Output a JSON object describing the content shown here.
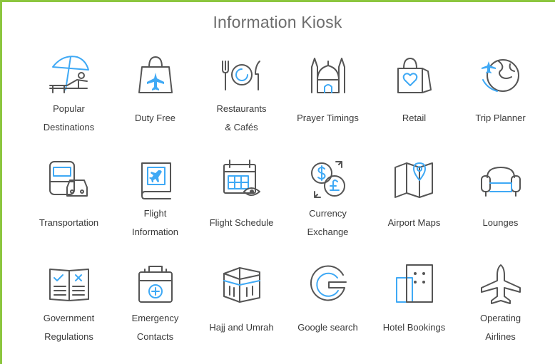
{
  "title": "Information Kiosk",
  "colors": {
    "accent": "#3fa9f5",
    "frame": "#8cc63f",
    "icon": "#555555",
    "text": "#3a3a3a"
  },
  "tiles": [
    {
      "icon": "beach-umbrella-icon",
      "lines": [
        "Popular",
        "Destinations"
      ]
    },
    {
      "icon": "shopping-bag-plane-icon",
      "lines": [
        "Duty Free"
      ]
    },
    {
      "icon": "plate-cutlery-icon",
      "lines": [
        "Restaurants",
        "& Cafés"
      ]
    },
    {
      "icon": "mosque-icon",
      "lines": [
        "Prayer Timings"
      ]
    },
    {
      "icon": "shopping-bag-heart-icon",
      "lines": [
        "Retail"
      ]
    },
    {
      "icon": "globe-plane-icon",
      "lines": [
        "Trip Planner"
      ]
    },
    {
      "icon": "bus-car-icon",
      "lines": [
        "Transportation"
      ]
    },
    {
      "icon": "book-plane-icon",
      "lines": [
        "Flight",
        "Information"
      ]
    },
    {
      "icon": "calendar-eye-icon",
      "lines": [
        "Flight Schedule"
      ]
    },
    {
      "icon": "currency-exchange-icon",
      "lines": [
        "Currency",
        "Exchange"
      ]
    },
    {
      "icon": "map-pin-icon",
      "lines": [
        "Airport Maps"
      ]
    },
    {
      "icon": "armchair-icon",
      "lines": [
        "Lounges"
      ]
    },
    {
      "icon": "regulations-book-icon",
      "lines": [
        "Government",
        "Regulations"
      ]
    },
    {
      "icon": "first-aid-kit-icon",
      "lines": [
        "Emergency",
        "Contacts"
      ]
    },
    {
      "icon": "kaaba-icon",
      "lines": [
        "Hajj and Umrah"
      ]
    },
    {
      "icon": "google-icon",
      "lines": [
        "Google search"
      ]
    },
    {
      "icon": "hotel-building-icon",
      "lines": [
        "Hotel Bookings"
      ]
    },
    {
      "icon": "airplane-icon",
      "lines": [
        "Operating",
        "Airlines"
      ]
    }
  ]
}
